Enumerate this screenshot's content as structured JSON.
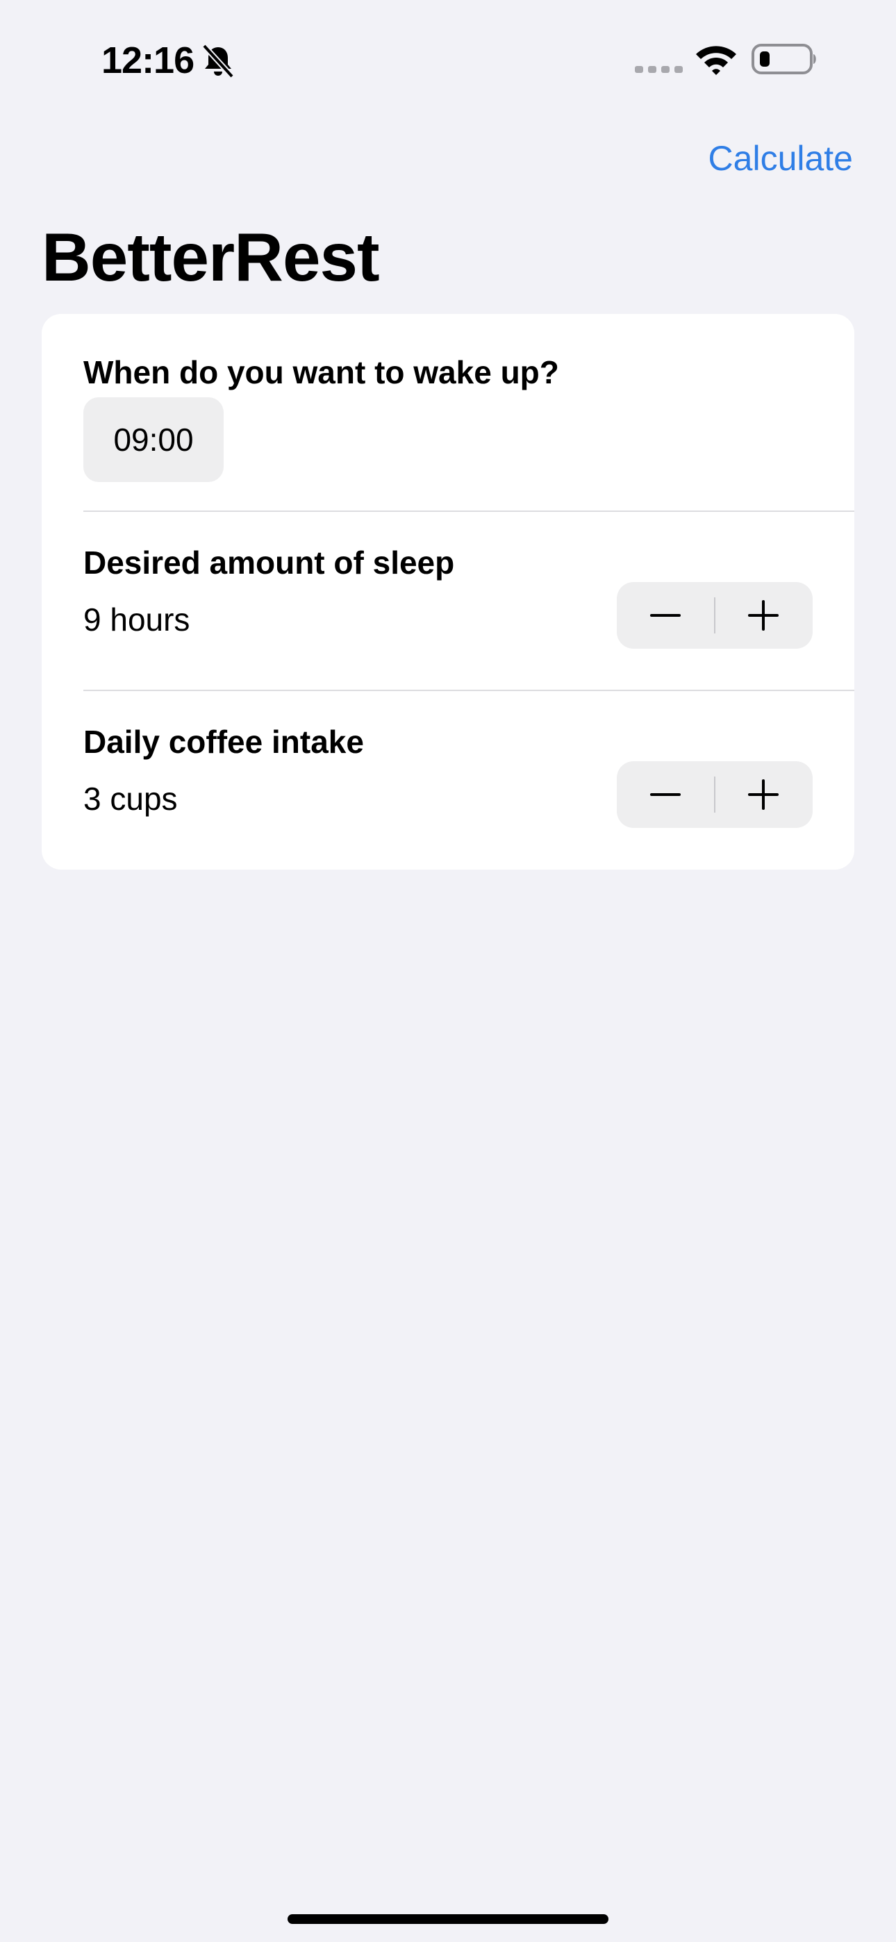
{
  "status_bar": {
    "time": "12:16"
  },
  "nav": {
    "calculate_label": "Calculate",
    "accent_color": "#2f7ee6"
  },
  "page": {
    "title": "BetterRest"
  },
  "form": {
    "wake_up": {
      "label": "When do you want to wake up?",
      "time_value": "09:00"
    },
    "sleep_amount": {
      "label": "Desired amount of sleep",
      "value_text": "9 hours"
    },
    "coffee_intake": {
      "label": "Daily coffee intake",
      "value_text": "3 cups"
    }
  },
  "icons": {
    "silent": "bell-slash-icon",
    "signal": "cellular-signal-icon",
    "wifi": "wifi-icon",
    "battery": "battery-low-icon",
    "decrement": "minus-icon",
    "increment": "plus-icon"
  }
}
